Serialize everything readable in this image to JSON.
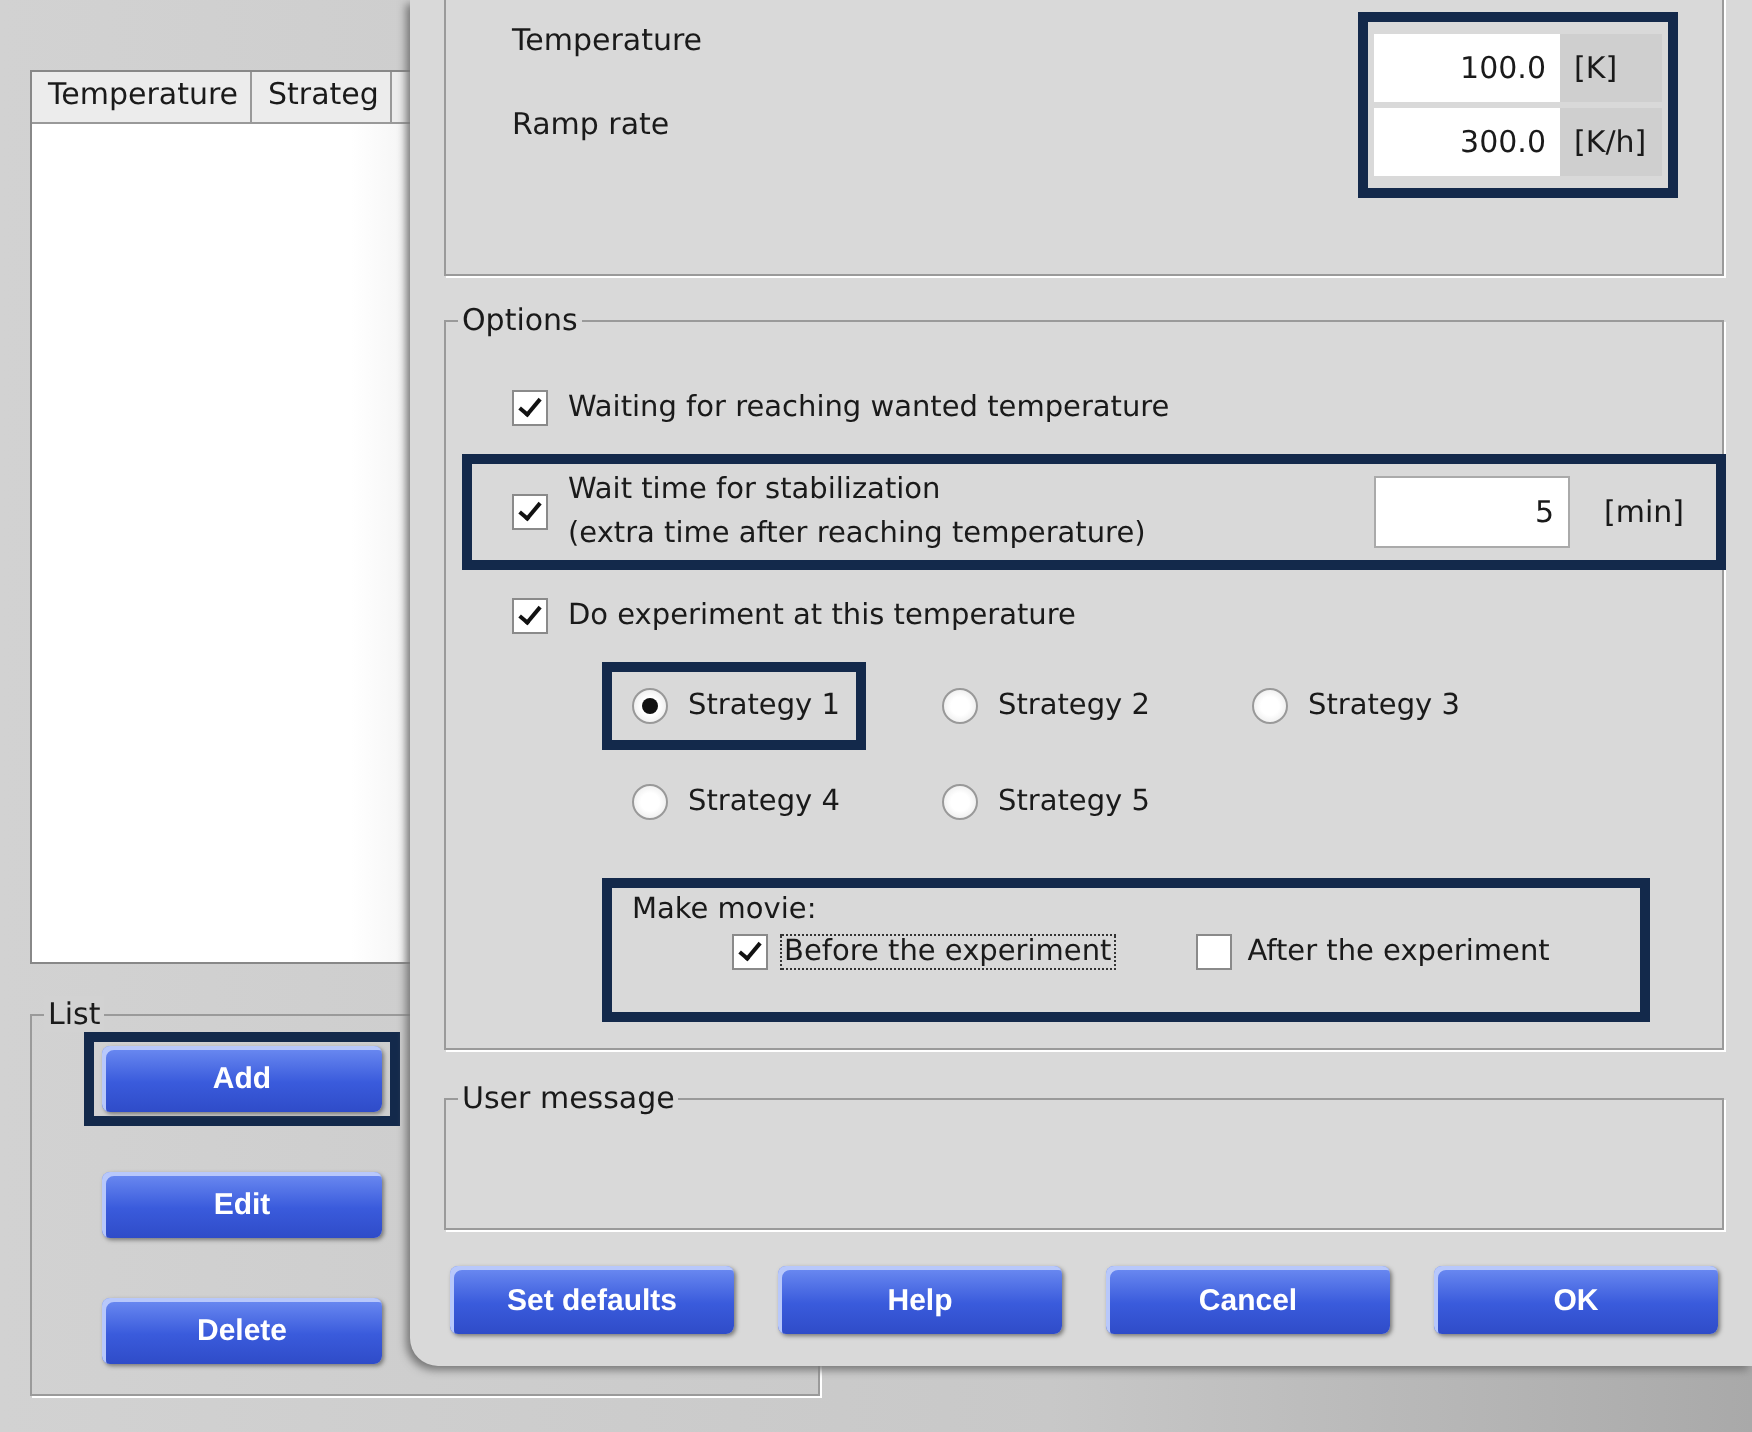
{
  "background_window": {
    "list_columns": [
      "Temperature",
      "Strateg"
    ],
    "list_group": {
      "title": "List",
      "buttons": [
        {
          "label": "Add",
          "highlighted": true
        },
        {
          "label": "Edit",
          "highlighted": false
        },
        {
          "label": "Delete",
          "highlighted": false
        }
      ]
    }
  },
  "dialog": {
    "setpoint": {
      "highlighted": true,
      "fields": [
        {
          "label": "Temperature",
          "value": "100.0",
          "unit": "[K]"
        },
        {
          "label": "Ramp rate",
          "value": "300.0",
          "unit": "[K/h]"
        }
      ]
    },
    "options": {
      "title": "Options",
      "waiting": {
        "label": "Waiting for reaching wanted temperature",
        "checked": true,
        "highlighted": false
      },
      "wait_time": {
        "label_lines": [
          "Wait time for stabilization",
          "(extra time after reaching temperature)"
        ],
        "checked": true,
        "value": "5",
        "unit": "[min]",
        "highlighted": true
      },
      "do_experiment": {
        "label": "Do experiment at this temperature",
        "checked": true
      },
      "strategies": [
        {
          "label": "Strategy 1",
          "selected": true,
          "highlighted": true
        },
        {
          "label": "Strategy 2",
          "selected": false,
          "highlighted": false
        },
        {
          "label": "Strategy 3",
          "selected": false,
          "highlighted": false
        },
        {
          "label": "Strategy 4",
          "selected": false,
          "highlighted": false
        },
        {
          "label": "Strategy 5",
          "selected": false,
          "highlighted": false
        }
      ],
      "movie": {
        "title": "Make movie:",
        "highlighted": true,
        "options": [
          {
            "label": "Before the experiment",
            "checked": true,
            "focused": true
          },
          {
            "label": "After the experiment",
            "checked": false,
            "focused": false
          }
        ]
      }
    },
    "user_message": {
      "title": "User message"
    },
    "buttons": [
      "Set defaults",
      "Help",
      "Cancel",
      "OK"
    ]
  }
}
